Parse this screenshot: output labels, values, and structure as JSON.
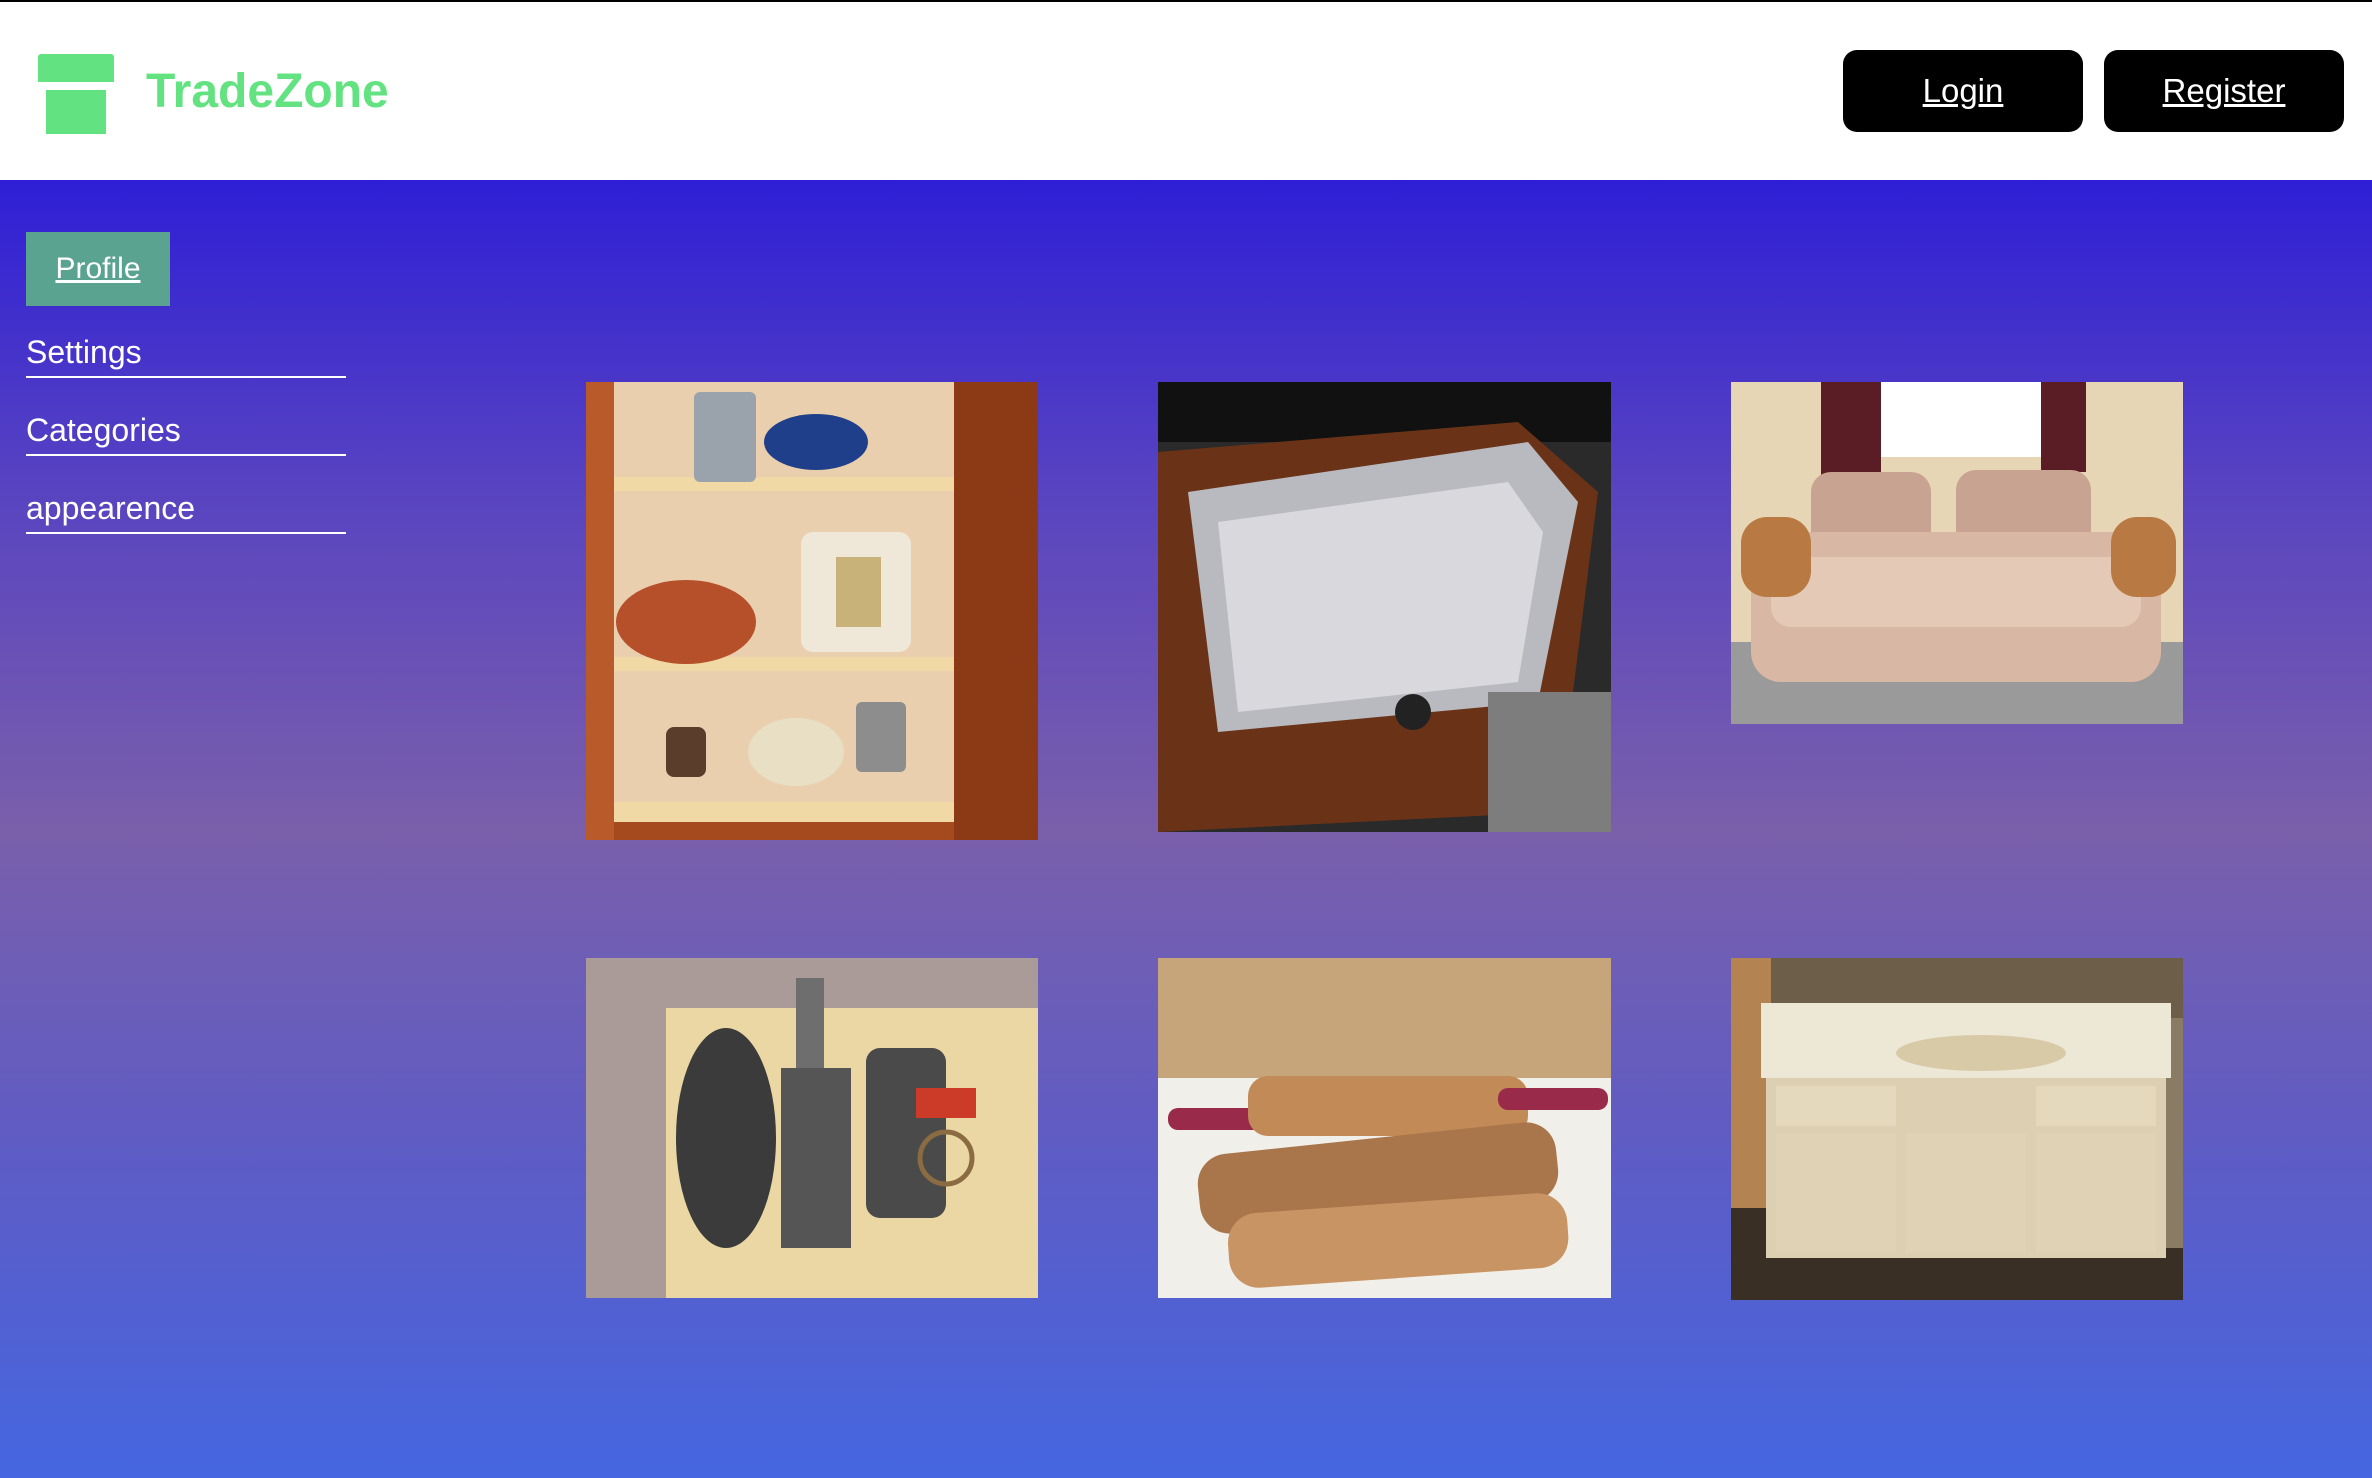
{
  "header": {
    "brand": "TradeZone",
    "logo_icon": "store-icon",
    "brand_color": "#63e281",
    "login_label": "Login",
    "register_label": "Register"
  },
  "sidebar": {
    "profile_label": "Profile",
    "items": [
      {
        "label": "Settings"
      },
      {
        "label": "Categories"
      },
      {
        "label": "appearence"
      }
    ]
  },
  "listings": [
    {
      "image": "kitchen-cabinet-photo"
    },
    {
      "image": "heater-photo"
    },
    {
      "image": "sofa-photo"
    },
    {
      "image": "engine-parts-photo"
    },
    {
      "image": "rolling-pins-photo"
    },
    {
      "image": "sink-cabinet-photo"
    }
  ],
  "colors": {
    "accent_green": "#63e281",
    "profile_bg": "#5ba391",
    "gradient_top": "#2e1fd6",
    "gradient_mid": "#7a5fab",
    "gradient_bottom": "#4566e0"
  }
}
